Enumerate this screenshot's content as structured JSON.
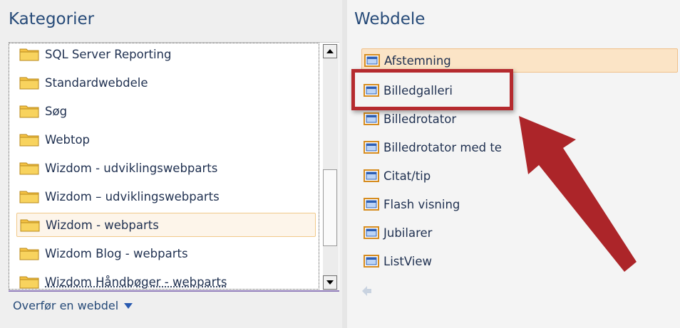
{
  "categories_panel": {
    "title": "Kategorier",
    "items": [
      {
        "label": "SQL Server Reporting",
        "selected": false
      },
      {
        "label": "Standardwebdele",
        "selected": false
      },
      {
        "label": "Søg",
        "selected": false
      },
      {
        "label": "Webtop",
        "selected": false
      },
      {
        "label": "Wizdom - udviklingswebparts",
        "selected": false
      },
      {
        "label": "Wizdom – udviklingswebparts",
        "selected": false
      },
      {
        "label": "Wizdom - webparts",
        "selected": true
      },
      {
        "label": "Wizdom Blog - webparts",
        "selected": false
      },
      {
        "label": "Wizdom Håndbøger - webparts",
        "selected": false
      }
    ],
    "upload_link": "Overfør en webdel",
    "icon": "folder-icon"
  },
  "webparts_panel": {
    "title": "Webdele",
    "items": [
      {
        "label": "Afstemning",
        "selected": true
      },
      {
        "label": "Billedgalleri",
        "selected": false
      },
      {
        "label": "Billedrotator",
        "selected": false
      },
      {
        "label": "Billedrotator med te",
        "selected": false
      },
      {
        "label": "Citat/tip",
        "selected": false
      },
      {
        "label": "Flash visning",
        "selected": false
      },
      {
        "label": "Jubilarer",
        "selected": false
      },
      {
        "label": "ListView",
        "selected": false
      }
    ],
    "icon": "webpart-icon"
  },
  "annotations": {
    "highlight_color": "#b52a2e",
    "arrow_color": "#a8191e"
  },
  "colors": {
    "title": "#264a78",
    "text": "#1f3050",
    "selected_bg": "#fbe4c6",
    "selected_border": "#f0c08a"
  }
}
